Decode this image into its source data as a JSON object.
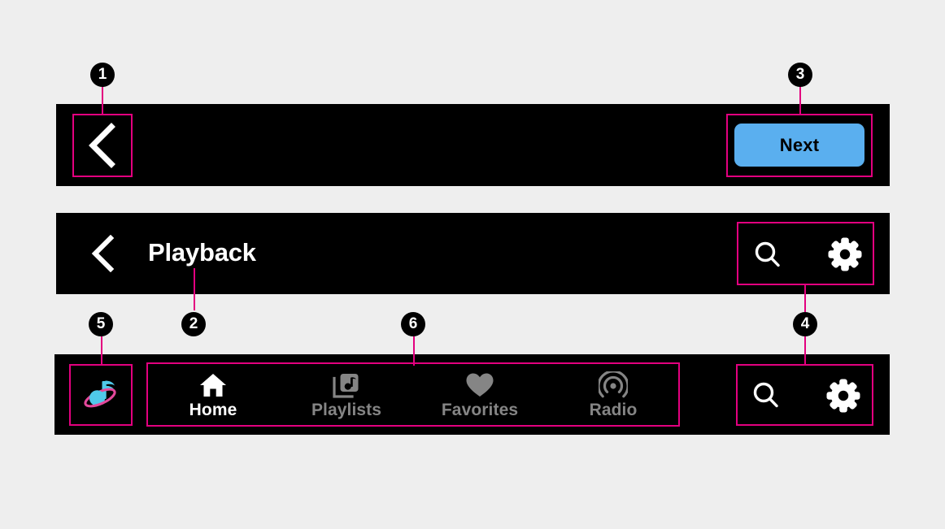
{
  "canvas": {
    "background": "#eeeeee",
    "bar_color": "#000000",
    "annotation_color": "#e3007f"
  },
  "top_toolbar": {
    "back_button": {
      "icon": "chevron-left-icon",
      "color": "#ffffff"
    },
    "next_button": {
      "label": "Next",
      "background": "#5aafef",
      "text_color": "#000000"
    }
  },
  "header_bar": {
    "back_button": {
      "icon": "chevron-left-icon",
      "color": "#ffffff"
    },
    "title": "Playback",
    "actions": [
      {
        "icon": "search-icon",
        "name": "search",
        "color": "#ffffff"
      },
      {
        "icon": "gear-icon",
        "name": "settings",
        "color": "#ffffff"
      }
    ]
  },
  "bottom_bar": {
    "logo": {
      "icon": "music-note-orbit-logo",
      "note_color": "#4fc9ea",
      "ring_color": "#e3489b"
    },
    "tabs": [
      {
        "label": "Home",
        "icon": "home-icon",
        "active": true,
        "color": "#ffffff"
      },
      {
        "label": "Playlists",
        "icon": "playlist-music-icon",
        "active": false,
        "color": "#858585"
      },
      {
        "label": "Favorites",
        "icon": "heart-icon",
        "active": false,
        "color": "#858585"
      },
      {
        "label": "Radio",
        "icon": "radio-broadcast-icon",
        "active": false,
        "color": "#858585"
      }
    ],
    "actions": [
      {
        "icon": "search-icon",
        "name": "search",
        "color": "#ffffff"
      },
      {
        "icon": "gear-icon",
        "name": "settings",
        "color": "#ffffff"
      }
    ]
  },
  "callouts": [
    {
      "number": "1",
      "target": "top-toolbar-back-button"
    },
    {
      "number": "2",
      "target": "header-title"
    },
    {
      "number": "3",
      "target": "next-button"
    },
    {
      "number": "4",
      "target": "action-icons"
    },
    {
      "number": "5",
      "target": "app-logo"
    },
    {
      "number": "6",
      "target": "nav-tabs"
    }
  ]
}
